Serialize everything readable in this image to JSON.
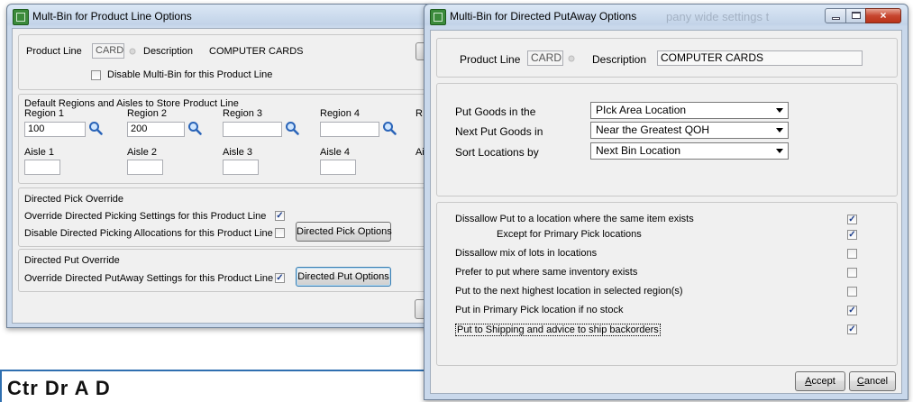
{
  "win1": {
    "title": "Mult-Bin for Product Line Options",
    "product_line_label": "Product Line",
    "product_line_value": "CARD",
    "description_label": "Description",
    "description_value": "COMPUTER CARDS",
    "disable_multibin_label": "Disable Multi-Bin for this Product Line",
    "disable_multibin_checked": false,
    "regions_heading": "Default Regions and Aisles to Store Product Line",
    "region_labels": [
      "Region 1",
      "Region 2",
      "Region 3",
      "Region 4",
      "R"
    ],
    "region_values": [
      "100",
      "200",
      "",
      ""
    ],
    "aisle_labels": [
      "Aisle 1",
      "Aisle 2",
      "Aisle 3",
      "Aisle 4",
      "Ai"
    ],
    "pick_heading": "Directed Pick Override",
    "override_pick_label": "Override Directed Picking Settings for this Product Line",
    "override_pick_checked": true,
    "disable_pick_label": "Disable Directed Picking Allocations for this Product Line",
    "disable_pick_checked": false,
    "pick_options_button": "Directed Pick Options",
    "put_heading": "Directed Put Override",
    "override_put_label": "Override Directed PutAway Settings for this Product Line",
    "override_put_checked": true,
    "put_options_button": "Directed Put Options"
  },
  "win2": {
    "title": "Multi-Bin for Directed PutAway Options",
    "title_bg_text": "pany wide settings t",
    "product_line_label": "Product Line",
    "product_line_value": "CARD",
    "description_label": "Description",
    "description_value": "COMPUTER CARDS",
    "put_goods_label": "Put Goods in the",
    "put_goods_value": "PIck Area Location",
    "next_put_label": "Next Put Goods in",
    "next_put_value": "Near the Greatest QOH",
    "sort_label": "Sort Locations by",
    "sort_value": "Next Bin Location",
    "options": [
      {
        "label": "Dissallow Put to a location where the same item exists",
        "checked": true
      },
      {
        "label": "Except for Primary Pick locations",
        "checked": true
      },
      {
        "label": "Dissallow mix of lots in locations",
        "checked": false
      },
      {
        "label": "Prefer to put where same inventory exists",
        "checked": false
      },
      {
        "label": "Put to the next highest location in selected region(s)",
        "checked": false
      },
      {
        "label": "Put in Primary Pick location if no stock",
        "checked": true
      },
      {
        "label": "Put to Shipping and advice to ship backorders",
        "checked": true
      }
    ],
    "accept_button": "ccept",
    "accept_accel": "A",
    "cancel_button": "ancel",
    "cancel_accel": "C"
  },
  "background_heading": "Ctr    Dr  A  D",
  "colors": {
    "checkmark": "#1c3d8c",
    "titlebar": "#c2d3e8",
    "close_button": "#c7462f"
  }
}
